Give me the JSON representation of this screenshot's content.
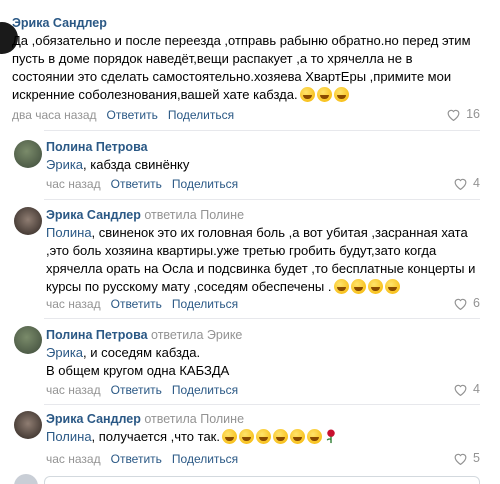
{
  "comments": [
    {
      "author": "Эрика Сандлер",
      "reply_to": "",
      "mention": "",
      "text": "Да ,обязательно и после переезда ,отправь рабыню обратно.но перед этим\nпусть в доме порядок наведёт,вещи распакует ,а то хрячелла не в\nсостоянии это сделать самостоятельно.хозяева ХвартЕры ,примите мои\nискренние соболезнования,вашей хате кабзда.",
      "emoji_count": 3,
      "time": "два часа назад",
      "reply_label": "Ответить",
      "share_label": "Поделиться",
      "likes": "16"
    },
    {
      "author": "Полина Петрова",
      "reply_to": "",
      "mention": "Эрика",
      "text": ", кабзда свинёнку",
      "emoji_count": 0,
      "time": "час назад",
      "reply_label": "Ответить",
      "share_label": "Поделиться",
      "likes": "4"
    },
    {
      "author": "Эрика Сандлер",
      "reply_to": "ответила Полине",
      "mention": "Полина",
      "text": ", свиненок это их головная боль ,а вот убитая ,засранная хата\n,это боль хозяина квартиры.уже третью гробить будут,зато когда\nхрячелла орать на Осла и подсвинка будет ,то бесплатные концерты и\nкурсы по русскому мату ,соседям обеспечены .",
      "emoji_count": 4,
      "time": "час назад",
      "reply_label": "Ответить",
      "share_label": "Поделиться",
      "likes": "6"
    },
    {
      "author": "Полина Петрова",
      "reply_to": "ответила Эрике",
      "mention": "Эрика",
      "text": ", и соседям кабздa.\nВ общем кругом одна КАБЗДА",
      "emoji_count": 0,
      "time": "час назад",
      "reply_label": "Ответить",
      "share_label": "Поделиться",
      "likes": "4"
    },
    {
      "author": "Эрика Сандлер",
      "reply_to": "ответила Полине",
      "mention": "Полина",
      "text": ", получается ,что так.",
      "emoji_count": 6,
      "time": "час назад",
      "reply_label": "Ответить",
      "share_label": "Поделиться",
      "likes": "5"
    }
  ],
  "colors": {
    "link": "#2a5885",
    "meta": "#939393",
    "divider": "#e7e8ec"
  }
}
